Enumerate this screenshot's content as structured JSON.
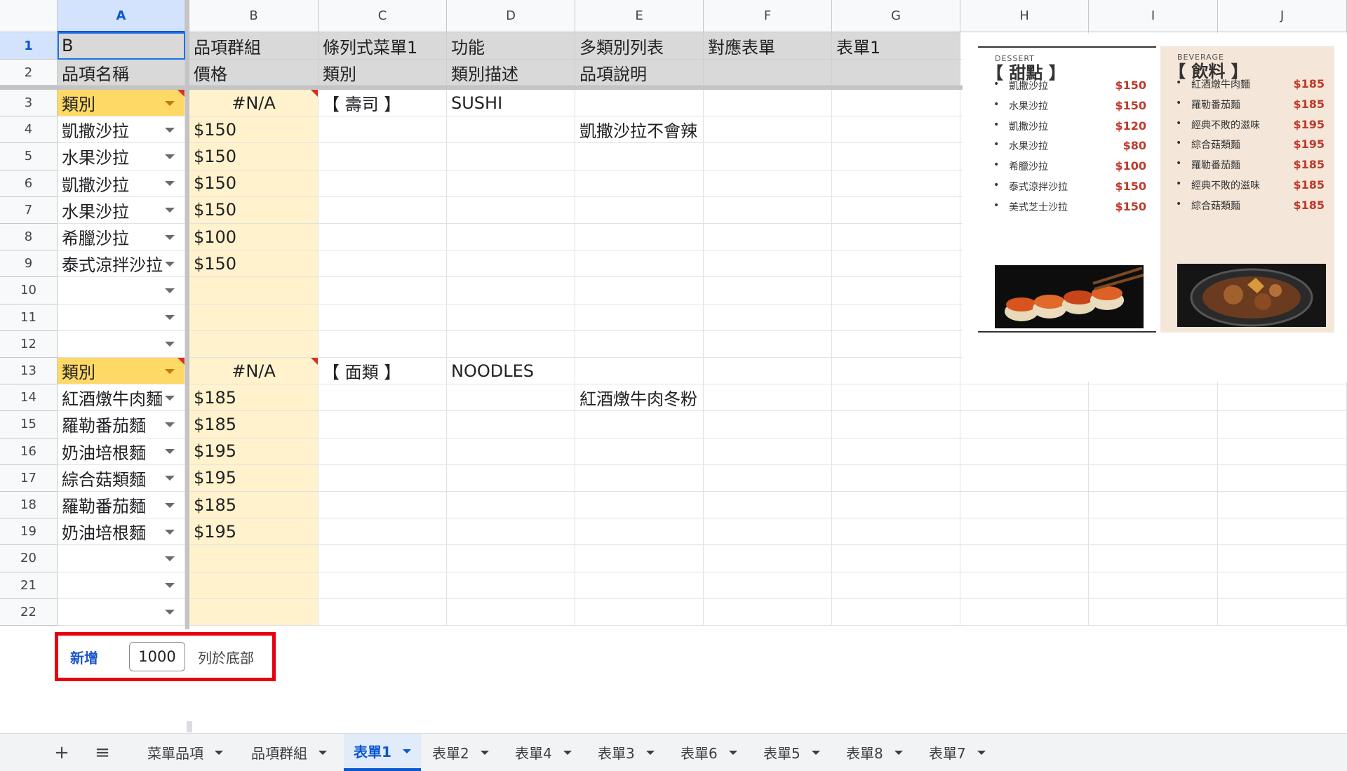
{
  "columns": [
    "A",
    "B",
    "C",
    "D",
    "E",
    "F",
    "G",
    "H",
    "I",
    "J"
  ],
  "selected_column": "A",
  "rows": [
    {
      "num": "1",
      "cells": [
        "B",
        "品項群組",
        "條列式菜單1",
        "功能",
        "多類別列表",
        "對應表單",
        "表單1",
        "",
        "",
        ""
      ]
    },
    {
      "num": "2",
      "cells": [
        "品項名稱",
        "價格",
        "類別",
        "類別描述",
        "品項說明",
        "",
        "",
        "",
        "",
        ""
      ]
    },
    {
      "num": "3",
      "cells": [
        "類別",
        "#N/A",
        "【 壽司 】",
        "SUSHI",
        "",
        "",
        "",
        "",
        "",
        ""
      ]
    },
    {
      "num": "4",
      "cells": [
        "凱撒沙拉",
        "$150",
        "",
        "",
        "凱撒沙拉不會辣",
        "",
        "",
        "",
        "",
        ""
      ]
    },
    {
      "num": "5",
      "cells": [
        "水果沙拉",
        "$150",
        "",
        "",
        "",
        "",
        "",
        "",
        "",
        ""
      ]
    },
    {
      "num": "6",
      "cells": [
        "凱撒沙拉",
        "$150",
        "",
        "",
        "",
        "",
        "",
        "",
        "",
        ""
      ]
    },
    {
      "num": "7",
      "cells": [
        "水果沙拉",
        "$150",
        "",
        "",
        "",
        "",
        "",
        "",
        "",
        ""
      ]
    },
    {
      "num": "8",
      "cells": [
        "希臘沙拉",
        "$100",
        "",
        "",
        "",
        "",
        "",
        "",
        "",
        ""
      ]
    },
    {
      "num": "9",
      "cells": [
        "泰式涼拌沙拉",
        "$150",
        "",
        "",
        "",
        "",
        "",
        "",
        "",
        ""
      ]
    },
    {
      "num": "10",
      "cells": [
        "",
        "",
        "",
        "",
        "",
        "",
        "",
        "",
        "",
        ""
      ]
    },
    {
      "num": "11",
      "cells": [
        "",
        "",
        "",
        "",
        "",
        "",
        "",
        "",
        "",
        ""
      ]
    },
    {
      "num": "12",
      "cells": [
        "",
        "",
        "",
        "",
        "",
        "",
        "",
        "",
        "",
        ""
      ]
    },
    {
      "num": "13",
      "cells": [
        "類別",
        "#N/A",
        "【 面類 】",
        "NOODLES",
        "",
        "",
        "",
        "",
        "",
        ""
      ]
    },
    {
      "num": "14",
      "cells": [
        "紅酒燉牛肉麵",
        "$185",
        "",
        "",
        "紅酒燉牛肉冬粉",
        "",
        "",
        "",
        "",
        ""
      ]
    },
    {
      "num": "15",
      "cells": [
        "羅勒番茄麵",
        "$185",
        "",
        "",
        "",
        "",
        "",
        "",
        "",
        ""
      ]
    },
    {
      "num": "16",
      "cells": [
        "奶油培根麵",
        "$195",
        "",
        "",
        "",
        "",
        "",
        "",
        "",
        ""
      ]
    },
    {
      "num": "17",
      "cells": [
        "綜合菇類麵",
        "$195",
        "",
        "",
        "",
        "",
        "",
        "",
        "",
        ""
      ]
    },
    {
      "num": "18",
      "cells": [
        "羅勒番茄麵",
        "$185",
        "",
        "",
        "",
        "",
        "",
        "",
        "",
        ""
      ]
    },
    {
      "num": "19",
      "cells": [
        "奶油培根麵",
        "$195",
        "",
        "",
        "",
        "",
        "",
        "",
        "",
        ""
      ]
    },
    {
      "num": "20",
      "cells": [
        "",
        "",
        "",
        "",
        "",
        "",
        "",
        "",
        "",
        ""
      ]
    },
    {
      "num": "21",
      "cells": [
        "",
        "",
        "",
        "",
        "",
        "",
        "",
        "",
        "",
        ""
      ]
    },
    {
      "num": "22",
      "cells": [
        "",
        "",
        "",
        "",
        "",
        "",
        "",
        "",
        "",
        ""
      ]
    }
  ],
  "add_rows": {
    "button_label": "新增",
    "count": "1000",
    "suffix": "列於底部"
  },
  "tabs": {
    "add_icon": "+",
    "list_icon": "≡",
    "items": [
      {
        "label": "菜單品項"
      },
      {
        "label": "品項群組"
      },
      {
        "label": "表單1",
        "active": true
      },
      {
        "label": "表單2"
      },
      {
        "label": "表單4"
      },
      {
        "label": "表單3"
      },
      {
        "label": "表單6"
      },
      {
        "label": "表單5"
      },
      {
        "label": "表單8"
      },
      {
        "label": "表單7"
      }
    ]
  },
  "menu_image": {
    "dessert": {
      "subtitle": "DESSERT",
      "title": "【 甜點 】",
      "items": [
        {
          "name": "凱撒沙拉",
          "price": "$150"
        },
        {
          "name": "水果沙拉",
          "price": "$150"
        },
        {
          "name": "凱撒沙拉",
          "price": "$120"
        },
        {
          "name": "水果沙拉",
          "price": "$80"
        },
        {
          "name": "希臘沙拉",
          "price": "$100"
        },
        {
          "name": "泰式涼拌沙拉",
          "price": "$150"
        },
        {
          "name": "美式芝士沙拉",
          "price": "$150"
        }
      ]
    },
    "beverage": {
      "subtitle": "BEVERAGE",
      "title": "【 飲料 】",
      "items": [
        {
          "name": "紅酒燉牛肉麵",
          "price": "$185"
        },
        {
          "name": "羅勒番茄麵",
          "price": "$185"
        },
        {
          "name": "經典不敗的滋味",
          "price": "$195"
        },
        {
          "name": "綜合菇類麵",
          "price": "$195"
        },
        {
          "name": "羅勒番茄麵",
          "price": "$185"
        },
        {
          "name": "經典不敗的滋味",
          "price": "$185"
        },
        {
          "name": "綜合菇類麵",
          "price": "$185"
        }
      ]
    }
  },
  "colors": {
    "header_gray": "#d9d9d9",
    "price_col": "#fff2cc",
    "category": "#ffd966",
    "selection": "#1a73e8",
    "highlight_box": "#e8000b"
  }
}
